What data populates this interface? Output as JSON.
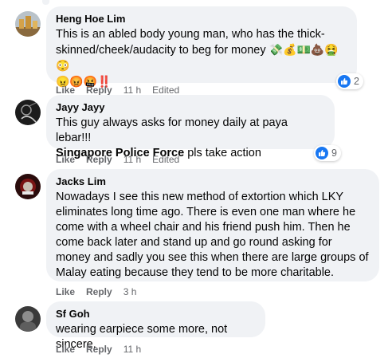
{
  "comments": [
    {
      "author": "Heng Hoe Lim",
      "line1": "This is an abled body young man, who has the thick-",
      "line2": "skinned/cheek/audacity to beg for money",
      "line2_emoji": "💸💰💵💩🤮😳",
      "line3_emoji": "😠😡🤬‼️",
      "actions": {
        "like": "Like",
        "reply": "Reply",
        "time": "11 h",
        "edited": "Edited"
      },
      "reaction_count": "2"
    },
    {
      "author": "Jayy Jayy",
      "line1": "This guy always asks for money daily at paya lebar!!!",
      "mention": "Singapore Police Force",
      "line2_rest": " pls take action",
      "actions": {
        "like": "Like",
        "reply": "Reply",
        "time": "11 h",
        "edited": "Edited"
      },
      "reaction_count": "9"
    },
    {
      "author": "Jacks Lim",
      "lines": [
        "Nowadays I see this new method of extortion which LKY",
        "eliminates long time ago. There is even one man where he",
        "come with a wheel chair and his friend push him. Then he",
        "come back later and stand up and go round asking for",
        "money and sadly you see this when there are large groups of",
        "Malay eating because they tend to be more charitable."
      ],
      "actions": {
        "like": "Like",
        "reply": "Reply",
        "time": "3 h"
      }
    },
    {
      "author": "Sf Goh",
      "line1": "wearing earpiece some more, not sincere.",
      "actions": {
        "like": "Like",
        "reply": "Reply",
        "time": "11 h"
      }
    }
  ],
  "icons": {
    "reaction": "thumbs-up-icon"
  },
  "colors": {
    "bubble": "#f0f2f5",
    "meta": "#65676b",
    "like_blue": "#1877f2"
  }
}
